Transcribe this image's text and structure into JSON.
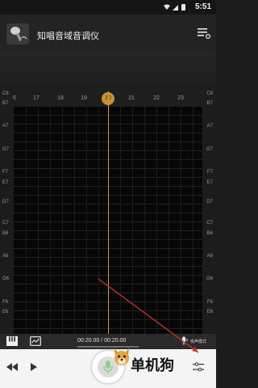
{
  "status_bar": {
    "time": "5:51",
    "icons": [
      "wifi-icon",
      "signal-icon",
      "battery-icon"
    ]
  },
  "app_bar": {
    "title": "知唱音域音调仪",
    "menu_icon": "menu-list-icon"
  },
  "ruler": {
    "ticks": [
      "6",
      "17",
      "18",
      "19",
      "21",
      "22",
      "23"
    ],
    "current": "20"
  },
  "notes": {
    "left": [
      "C8",
      "B7",
      "A7",
      "G7",
      "F7",
      "E7",
      "D7",
      "C7",
      "B6",
      "A6",
      "G6",
      "F6",
      "E6"
    ],
    "right": [
      "C8",
      "B7",
      "A7",
      "G7",
      "F7",
      "E7",
      "D7",
      "C7",
      "B6",
      "A6",
      "G6",
      "F6",
      "E6"
    ]
  },
  "control_bar": {
    "time": "00:20.00 / 00:20.00",
    "mode_label": "练声模式",
    "progress": 1.0
  },
  "bottom_bar": {
    "watermark": "单机狗"
  },
  "colors": {
    "accent": "#c88f37",
    "cursor": "#d49a4a",
    "mic": "#8fd18a",
    "annotation_arrow": "#c0392b"
  }
}
